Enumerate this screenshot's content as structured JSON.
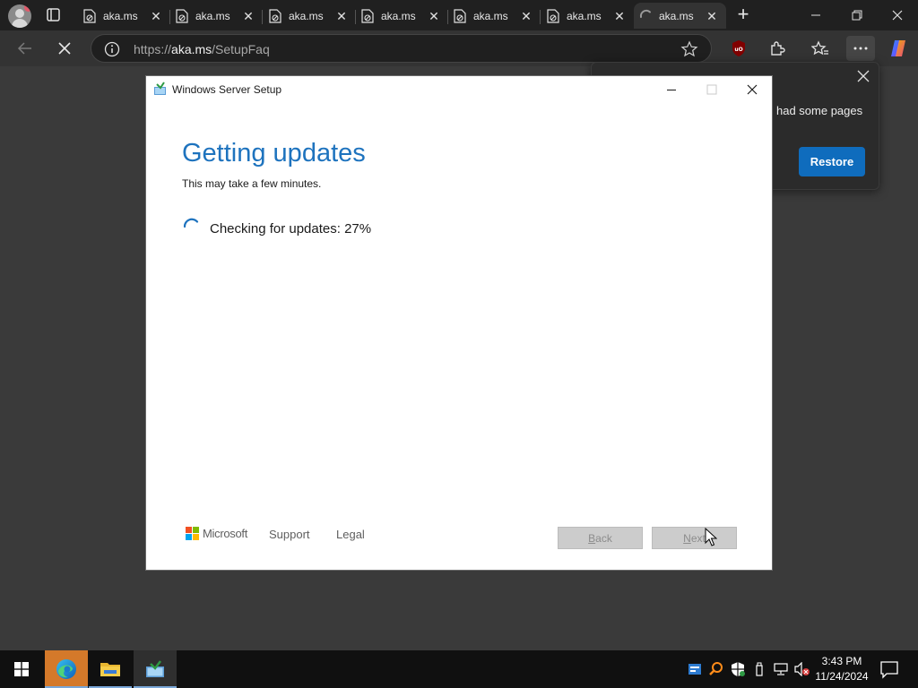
{
  "browser": {
    "tabs": [
      {
        "title": "aka.ms",
        "active": false
      },
      {
        "title": "aka.ms",
        "active": false
      },
      {
        "title": "aka.ms",
        "active": false
      },
      {
        "title": "aka.ms",
        "active": false
      },
      {
        "title": "aka.ms",
        "active": false
      },
      {
        "title": "aka.ms",
        "active": false
      },
      {
        "title": "aka.ms",
        "active": true,
        "loading": true
      }
    ],
    "address": {
      "prefix": "https://",
      "host": "aka.ms",
      "path": "/SetupFaq"
    },
    "icons": {
      "back": "back-arrow-icon",
      "stop": "stop-loading-icon",
      "favorite": "star-icon",
      "ublock": "ublock-origin-icon",
      "extensions": "puzzle-icon",
      "favorites": "favorites-icon",
      "more": "more-icon",
      "copilot": "copilot-icon"
    }
  },
  "restore_popup": {
    "text": "had some pages",
    "button": "Restore"
  },
  "setup": {
    "window_title": "Windows Server Setup",
    "heading": "Getting updates",
    "subheading": "This may take a few minutes.",
    "status": "Checking for updates: 27%",
    "progress_percent": 27,
    "footer": {
      "brand": "Microsoft",
      "support": "Support",
      "legal": "Legal"
    },
    "buttons": {
      "back_rest": "ack",
      "back_key": "B",
      "next_rest": "ext",
      "next_key": "N"
    }
  },
  "taskbar": {
    "time": "3:43 PM",
    "date": "11/24/2024"
  },
  "colors": {
    "accent": "#1e73be",
    "restore_button": "#0f6cbd",
    "ms_red": "#f25022",
    "ms_green": "#7fba00",
    "ms_blue": "#00a4ef",
    "ms_yellow": "#ffb900"
  }
}
